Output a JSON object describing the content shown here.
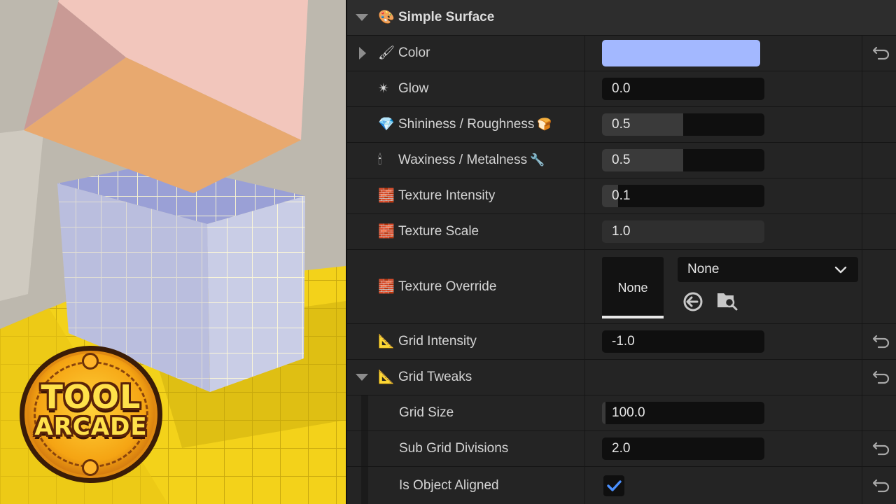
{
  "panel": {
    "section_icon": "palette-icon",
    "section_title": "Simple Surface",
    "properties": [
      {
        "icon": "paintbrush-icon",
        "emoji": "🖌",
        "label": "Color",
        "color": "#a3b8ff"
      },
      {
        "icon": "sparkle-icon",
        "emoji": "✴",
        "label": "Glow",
        "value": "0.0"
      },
      {
        "icon": "diamond-icon",
        "emoji": "💎",
        "label": "Shininess / Roughness",
        "tail_icon": "bread-icon",
        "tail": "🍞",
        "value": "0.5",
        "fill": 0.5
      },
      {
        "icon": "candle-icon",
        "emoji": "🕯",
        "label": "Waxiness / Metalness",
        "tail_icon": "wrench-icon",
        "tail": "🔧",
        "value": "0.5",
        "fill": 0.5
      },
      {
        "icon": "bricks-icon",
        "emoji": "🧱",
        "label": "Texture Intensity",
        "value": "0.1",
        "fill": 0.1
      },
      {
        "icon": "bricks-icon",
        "emoji": "🧱",
        "label": "Texture Scale",
        "value": "1.0"
      },
      {
        "icon": "bricks-icon",
        "emoji": "🧱",
        "label": "Texture Override",
        "thumb": "None",
        "combo": "None"
      },
      {
        "icon": "triangle-ruler-icon",
        "emoji": "📐",
        "label": "Grid Intensity",
        "value": "-1.0"
      },
      {
        "icon": "triangle-ruler-icon",
        "emoji": "📐",
        "label": "Grid Tweaks"
      },
      {
        "label": "Grid Size",
        "value": "100.0",
        "fill": 0.02
      },
      {
        "label": "Sub Grid Divisions",
        "value": "2.0"
      },
      {
        "label": "Is Object Aligned",
        "checked": true
      }
    ]
  },
  "logo": {
    "line1": "TOOL",
    "line2": "ARCADE"
  },
  "colors": {
    "panel_bg": "#242424",
    "field_bg": "#0f0f0f",
    "check_blue": "#4a90ff",
    "swatch": "#a3b8ff"
  }
}
